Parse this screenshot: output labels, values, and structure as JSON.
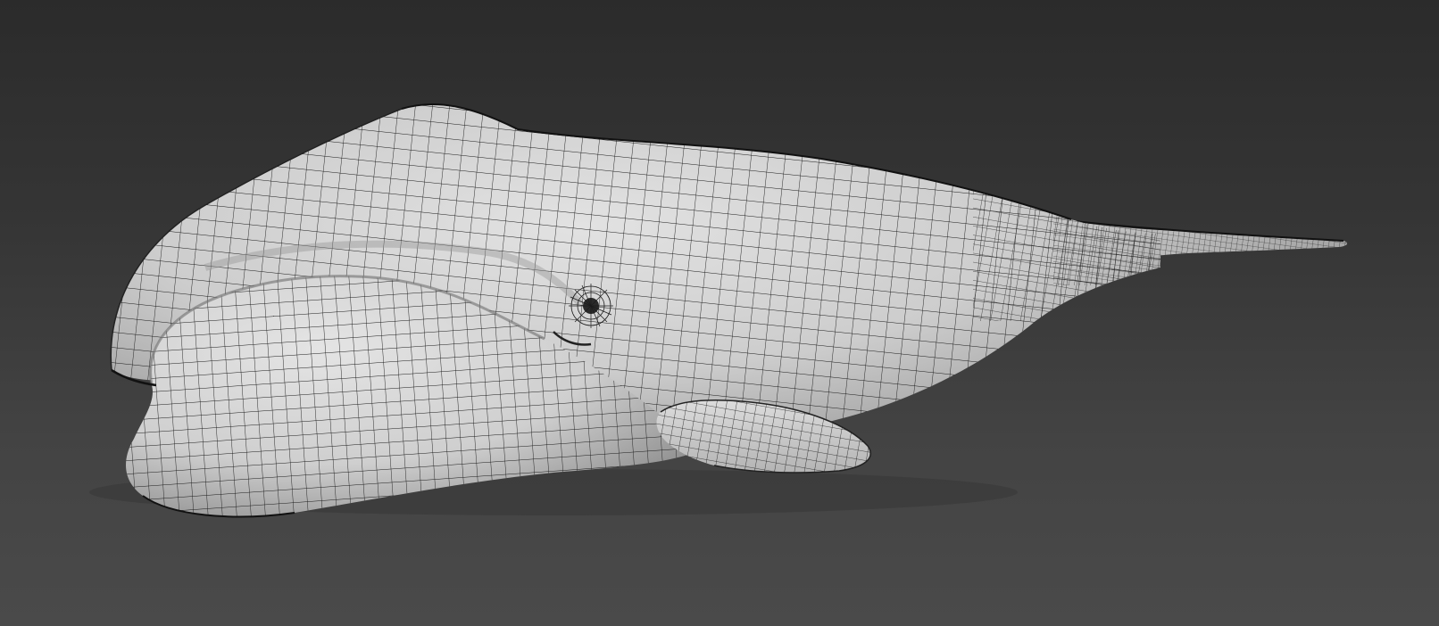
{
  "viewport": {
    "background_top": "#2b2b2b",
    "background_bottom": "#4a4a4a"
  },
  "model": {
    "surface_color": "#d7d7d7",
    "shadow_color": "#8e8e8e",
    "wire_color": "#1b1b1b"
  }
}
